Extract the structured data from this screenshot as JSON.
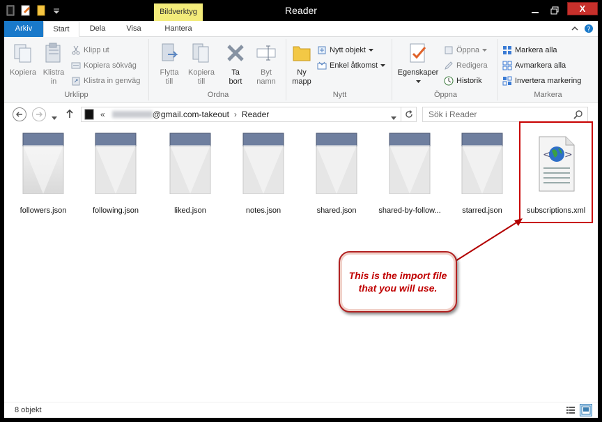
{
  "window": {
    "title": "Reader",
    "contextual_tab_header": "Bildverktyg",
    "close_glyph": "X"
  },
  "tabs": [
    {
      "label": "Arkiv"
    },
    {
      "label": "Start"
    },
    {
      "label": "Dela"
    },
    {
      "label": "Visa"
    },
    {
      "label": "Hantera"
    }
  ],
  "ribbon": {
    "urklipp": {
      "label": "Urklipp",
      "kopiera": "Kopiera",
      "klistra_in_1": "Klistra",
      "klistra_in_2": "in",
      "klipp_ut": "Klipp ut",
      "kopiera_sokvag": "Kopiera sökväg",
      "klistra_genvag": "Klistra in genväg"
    },
    "ordna": {
      "label": "Ordna",
      "flytta_1": "Flytta",
      "flytta_2": "till",
      "kopiera_1": "Kopiera",
      "kopiera_2": "till",
      "ta_bort_1": "Ta",
      "ta_bort_2": "bort",
      "byt_namn_1": "Byt",
      "byt_namn_2": "namn"
    },
    "nytt": {
      "label": "Nytt",
      "ny_mapp_1": "Ny",
      "ny_mapp_2": "mapp",
      "nytt_objekt": "Nytt objekt",
      "enkel_atkomst": "Enkel åtkomst"
    },
    "oppna": {
      "label": "Öppna",
      "egenskaper": "Egenskaper",
      "oppna": "Öppna",
      "redigera": "Redigera",
      "historik": "Historik"
    },
    "markera": {
      "label": "Markera",
      "markera_alla": "Markera alla",
      "avmarkera_alla": "Avmarkera alla",
      "invertera": "Invertera markering"
    }
  },
  "address": {
    "prefix": "«",
    "segment_1_suffix": "@gmail.com-takeout",
    "separator": "›",
    "segment_2": "Reader",
    "search_placeholder": "Sök i Reader"
  },
  "files": [
    {
      "name": "followers.json"
    },
    {
      "name": "following.json"
    },
    {
      "name": "liked.json"
    },
    {
      "name": "notes.json"
    },
    {
      "name": "shared.json"
    },
    {
      "name": "shared-by-follow..."
    },
    {
      "name": "starred.json"
    },
    {
      "name": "subscriptions.xml"
    }
  ],
  "callout": {
    "line1": "This is the import file",
    "line2": "that you will use."
  },
  "status": {
    "count": "8 objekt"
  },
  "colors": {
    "accent": "#1979ca",
    "callout_text": "#c00000",
    "highlight": "#c80000"
  }
}
